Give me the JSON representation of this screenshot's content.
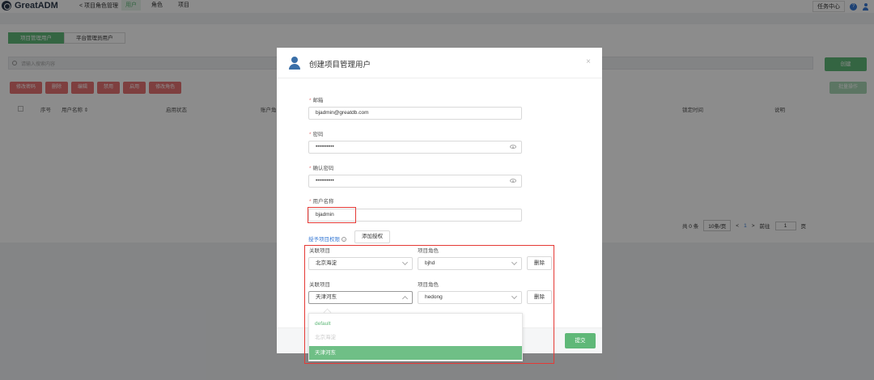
{
  "app": {
    "name": "GreatADM"
  },
  "topbar": {
    "back_label": "< 项目角色管理",
    "tabs": [
      {
        "label": "用户"
      },
      {
        "label": "角色"
      },
      {
        "label": "项目"
      }
    ],
    "task_center": "任务中心"
  },
  "page": {
    "subtabs": [
      {
        "label": "项目管理用户"
      },
      {
        "label": "平台管理员用户"
      }
    ],
    "search_placeholder": "请输入搜索内容",
    "create_label": "创建",
    "actions": [
      "修改密码",
      "删除",
      "编辑",
      "禁用",
      "启用",
      "修改角色"
    ],
    "batch_label": "批量操作",
    "columns": {
      "index": "序号",
      "username": "用户名称 ⇕",
      "status": "启用状态",
      "account": "账户角",
      "locked_time": "锁定时间",
      "description": "说明"
    },
    "pager": {
      "total": "共 0 条",
      "page_size": "10条/页",
      "prev": "<",
      "page": "1",
      "next": ">",
      "goto": "前往",
      "goto_value": "1",
      "page_unit": "页"
    }
  },
  "modal": {
    "title": "创建项目管理用户",
    "close": "×",
    "email_label": "邮箱",
    "email_value": "bjadmin@greatdb.com",
    "password_label": "密码",
    "password_value": "••••••••••",
    "confirm_label": "确认密码",
    "confirm_value": "••••••••••",
    "username_label": "用户名称",
    "username_value": "bjadmin",
    "grant_link": "授予项目权限",
    "add_grant": "添加授权",
    "project_label": "关联项目",
    "role_label": "项目角色",
    "grants": [
      {
        "project": "北京海淀",
        "role": "bjhd",
        "delete": "删除"
      },
      {
        "project": "天津河东",
        "role": "hedong",
        "delete": "删除"
      }
    ],
    "dropdown_options": [
      "default",
      "北京海淀",
      "天津河东"
    ],
    "submit_label": "提交"
  },
  "colors": {
    "primary": "#5fb878",
    "danger": "#e57373",
    "highlight": "#e53935",
    "link": "#3a7bd5"
  }
}
